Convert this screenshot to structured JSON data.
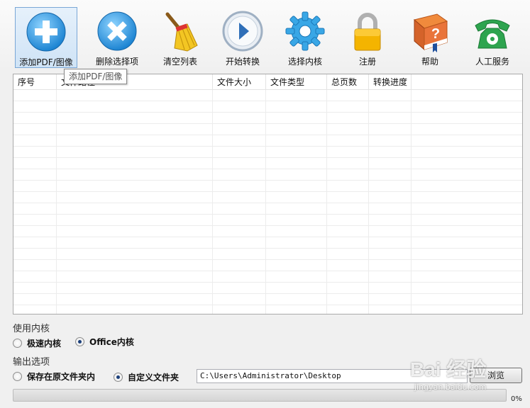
{
  "toolbar": {
    "buttons": [
      {
        "label": "添加PDF/图像",
        "icon": "plus-circle-icon"
      },
      {
        "label": "删除选择项",
        "icon": "x-circle-icon"
      },
      {
        "label": "清空列表",
        "icon": "broom-icon"
      },
      {
        "label": "开始转换",
        "icon": "play-icon"
      },
      {
        "label": "选择内核",
        "icon": "gear-icon"
      },
      {
        "label": "注册",
        "icon": "lock-icon"
      },
      {
        "label": "帮助",
        "icon": "help-book-icon"
      },
      {
        "label": "人工服务",
        "icon": "telephone-icon"
      }
    ],
    "tooltip": "添加PDF/图像"
  },
  "table": {
    "columns": [
      "序号",
      "文件路径",
      "文件大小",
      "文件类型",
      "总页数",
      "转换进度"
    ],
    "rows": []
  },
  "engine": {
    "title": "使用内核",
    "options": [
      "极速内核",
      "Office内核"
    ],
    "selected": "Office内核"
  },
  "output": {
    "title": "输出选项",
    "options": [
      "保存在原文件夹内",
      "自定义文件夹"
    ],
    "selected": "自定义文件夹",
    "path": "C:\\Users\\Administrator\\Desktop",
    "browse_label": "浏览"
  },
  "progress": {
    "value": 0,
    "text": "0%"
  },
  "watermark": {
    "main": "Bai 经验",
    "sub": "jingyan.baidu.com"
  },
  "colors": {
    "accent": "#2b8fd9",
    "selection_border": "#7aa7d6"
  }
}
